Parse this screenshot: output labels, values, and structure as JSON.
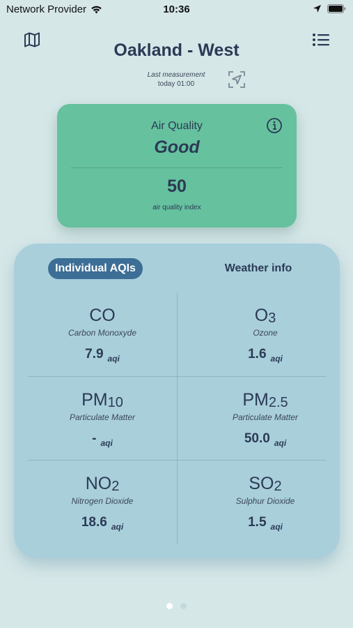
{
  "status_bar": {
    "carrier": "Network Provider",
    "time": "10:36"
  },
  "header": {
    "title": "Oakland - West",
    "last_measurement_label": "Last measurement",
    "last_measurement_time": "today 01:00"
  },
  "air_quality": {
    "title": "Air Quality",
    "status": "Good",
    "index_value": "50",
    "index_label": "air quality index",
    "card_color": "#66c19e"
  },
  "tabs": {
    "individual": "Individual AQIs",
    "weather": "Weather info",
    "active": "individual"
  },
  "pollutants": [
    {
      "formula_main": "CO",
      "formula_sub": "",
      "name": "Carbon Monoxyde",
      "value": "7.9",
      "unit": "aqi"
    },
    {
      "formula_main": "O",
      "formula_sub": "3",
      "name": "Ozone",
      "value": "1.6",
      "unit": "aqi"
    },
    {
      "formula_main": "PM",
      "formula_sub": "10",
      "name": "Particulate Matter",
      "value": "-",
      "unit": "aqi"
    },
    {
      "formula_main": "PM",
      "formula_sub": "2.5",
      "name": "Particulate Matter",
      "value": "50.0",
      "unit": "aqi"
    },
    {
      "formula_main": "NO",
      "formula_sub": "2",
      "name": "Nitrogen Dioxide",
      "value": "18.6",
      "unit": "aqi"
    },
    {
      "formula_main": "SO",
      "formula_sub": "2",
      "name": "Sulphur Dioxide",
      "value": "1.5",
      "unit": "aqi"
    }
  ],
  "icons": {
    "map": "map-icon",
    "menu": "list-menu-icon",
    "locate": "location-arrow-icon",
    "info": "info-icon",
    "wifi": "wifi-icon",
    "location": "location-services-icon",
    "battery": "battery-icon"
  },
  "pagination": {
    "total_pages": 2,
    "current_page": 1
  },
  "colors": {
    "background": "#d6e7e8",
    "panel": "#a9cfdb",
    "active_tab": "#3c6e96",
    "text_primary": "#2b3a55",
    "dot_active": "#ffffff",
    "dot_inactive": "#c3dadd"
  }
}
